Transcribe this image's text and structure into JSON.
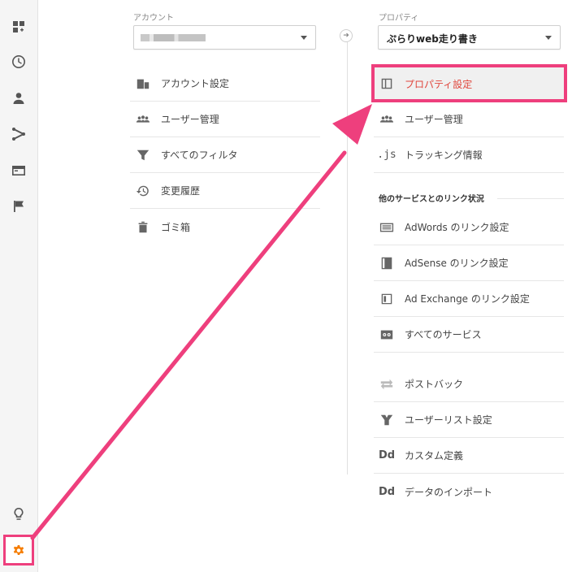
{
  "sidebar": {
    "items": [
      {
        "icon": "dashboard-icon"
      },
      {
        "icon": "clock-icon"
      },
      {
        "icon": "person-icon"
      },
      {
        "icon": "acquisition-icon"
      },
      {
        "icon": "behavior-icon"
      },
      {
        "icon": "flag-icon"
      }
    ],
    "bottom": [
      {
        "icon": "lightbulb-icon"
      },
      {
        "icon": "gear-icon"
      }
    ]
  },
  "account": {
    "label": "アカウント",
    "selected_value": "",
    "items": [
      {
        "icon": "building-icon",
        "label": "アカウント設定"
      },
      {
        "icon": "users-icon",
        "label": "ユーザー管理"
      },
      {
        "icon": "filter-icon",
        "label": "すべてのフィルタ"
      },
      {
        "icon": "history-icon",
        "label": "変更履歴"
      },
      {
        "icon": "trash-icon",
        "label": "ゴミ箱"
      }
    ]
  },
  "property": {
    "label": "プロパティ",
    "selected_value": "ぷらりweb走り書き",
    "items": [
      {
        "icon": "property-icon",
        "label": "プロパティ設定"
      },
      {
        "icon": "users-icon",
        "label": "ユーザー管理"
      },
      {
        "icon": "js-icon",
        "icon_text": ".js",
        "label": "トラッキング情報"
      }
    ],
    "links_heading": "他のサービスとのリンク状況",
    "link_items": [
      {
        "icon": "adwords-icon",
        "label": "AdWords のリンク設定"
      },
      {
        "icon": "adsense-icon",
        "label": "AdSense のリンク設定"
      },
      {
        "icon": "ad-exchange-icon",
        "label": "Ad Exchange のリンク設定"
      },
      {
        "icon": "all-services-icon",
        "label": "すべてのサービス"
      }
    ],
    "other_items": [
      {
        "icon": "postback-icon",
        "label": "ポストバック"
      },
      {
        "icon": "user-list-icon",
        "label": "ユーザーリスト設定"
      },
      {
        "icon": "dd-icon",
        "icon_text": "Dd",
        "label": "カスタム定義"
      },
      {
        "icon": "dd-icon",
        "icon_text": "Dd",
        "label": "データのインポート"
      }
    ]
  },
  "colors": {
    "highlight": "#ee3f7d",
    "active_text": "#e0453b",
    "gear": "#f57c00"
  }
}
